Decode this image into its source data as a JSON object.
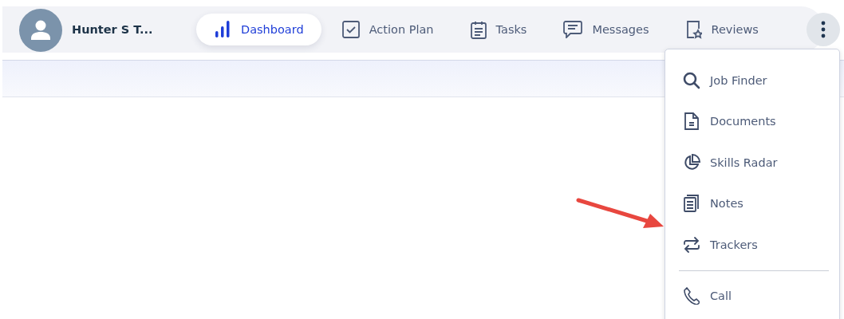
{
  "user": {
    "name": "Hunter S T..."
  },
  "tabs": [
    {
      "label": "Dashboard",
      "selected": true
    },
    {
      "label": "Action Plan",
      "selected": false
    },
    {
      "label": "Tasks",
      "selected": false
    },
    {
      "label": "Messages",
      "selected": false
    },
    {
      "label": "Reviews",
      "selected": false
    }
  ],
  "more_menu": {
    "expanded": true,
    "items": [
      {
        "label": "Job Finder",
        "divider_before": false
      },
      {
        "label": "Documents",
        "divider_before": false
      },
      {
        "label": "Skills Radar",
        "divider_before": false
      },
      {
        "label": "Notes",
        "divider_before": false
      },
      {
        "label": "Trackers",
        "divider_before": false
      },
      {
        "label": "Call",
        "divider_before": true
      }
    ]
  }
}
